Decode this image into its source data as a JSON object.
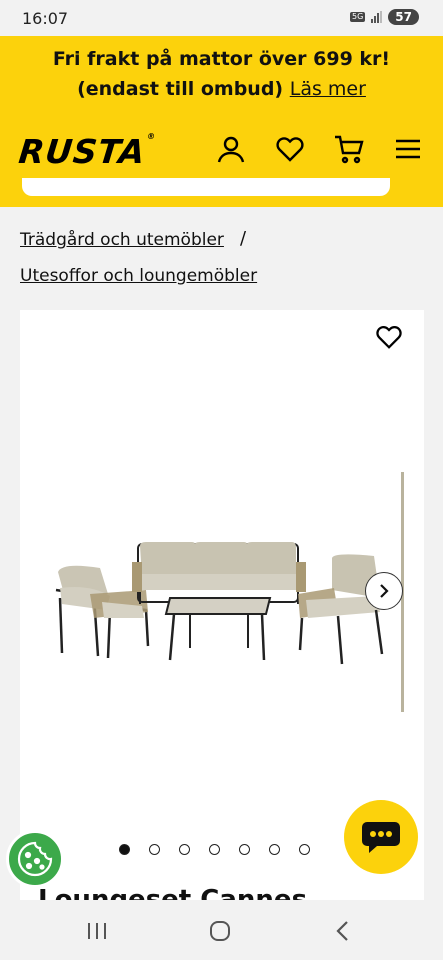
{
  "status_bar": {
    "time": "16:07",
    "network": "5G",
    "battery": "57"
  },
  "header": {
    "promo_line1": "Fri frakt på mattor över 699 kr!",
    "promo_line2": "(endast till ombud)",
    "promo_link": "Läs mer",
    "logo": "RUSTA",
    "logo_mark": "®",
    "icons": [
      "user-icon",
      "heart-icon",
      "cart-icon",
      "menu-icon"
    ]
  },
  "breadcrumb": {
    "items": [
      "Trädgård och utemöbler",
      "Utesoffor och loungemöbler"
    ],
    "separator": "/"
  },
  "product": {
    "image_count": 7,
    "active_image": 1,
    "title_partial": "Loungeset Cannes"
  },
  "colors": {
    "brand_yellow": "#fcd20c",
    "cookie_green": "#3ca94a"
  }
}
